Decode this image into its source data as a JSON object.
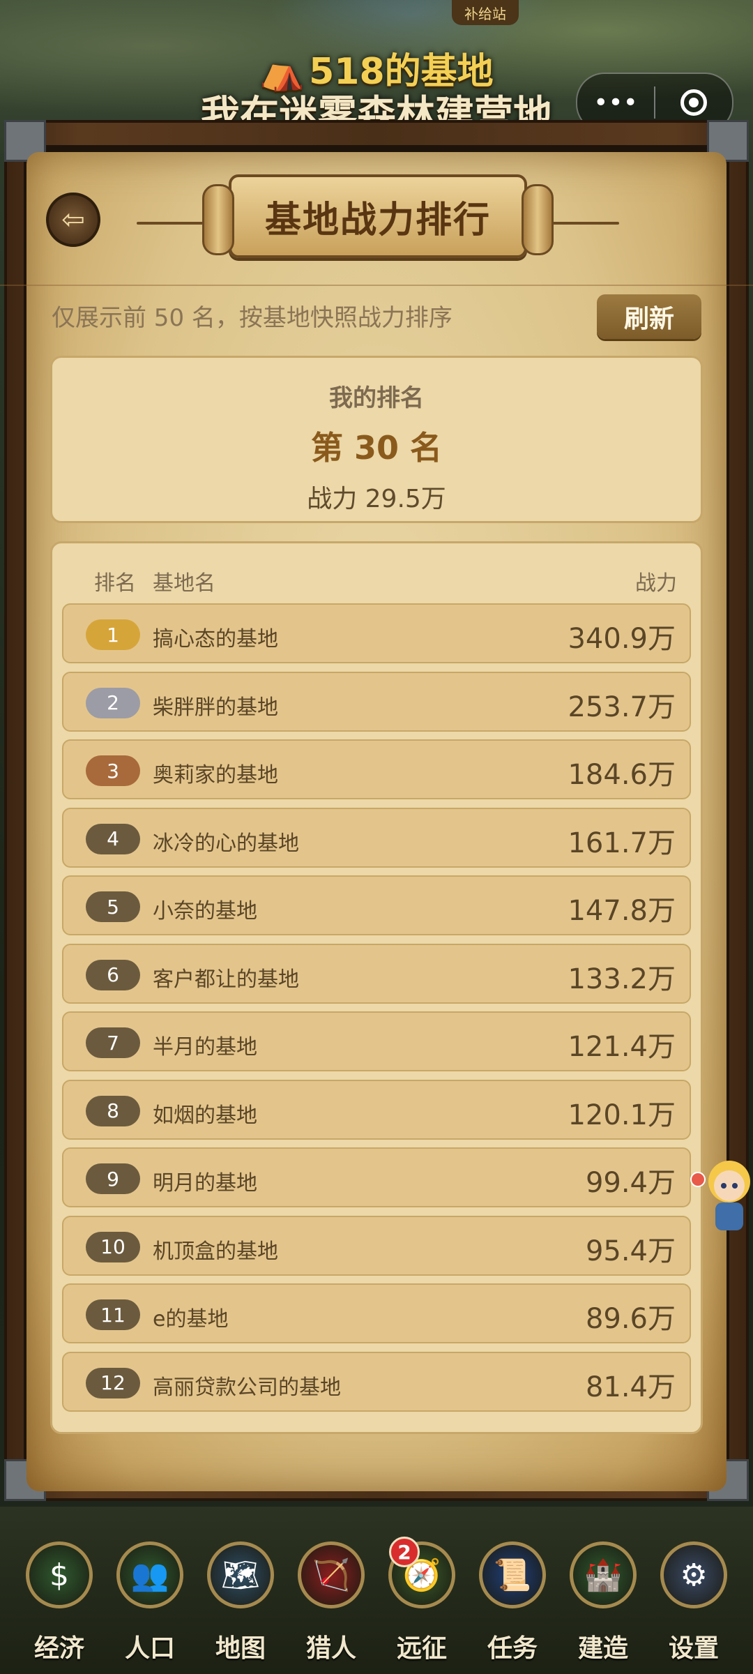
{
  "header": {
    "supply_badge": "补给站",
    "base_title": "518的基地",
    "game_subtitle": "我在迷雾森林建营地",
    "capsule_more": "•••"
  },
  "panel": {
    "title": "基地战力排行",
    "hint": "仅展示前 50 名，按基地快照战力排序",
    "refresh_label": "刷新"
  },
  "my_rank": {
    "label": "我的排名",
    "rank_text": "第 30 名",
    "power_text": "战力 29.5万"
  },
  "table": {
    "headers": {
      "rank": "排名",
      "name": "基地名",
      "power": "战力"
    },
    "rows": [
      {
        "rank": "1",
        "name": "搞心态的基地",
        "power": "340.9万",
        "color": "#d6a53a"
      },
      {
        "rank": "2",
        "name": "柴胖胖的基地",
        "power": "253.7万",
        "color": "#9c9ca6"
      },
      {
        "rank": "3",
        "name": "奥莉家的基地",
        "power": "184.6万",
        "color": "#a86a3a"
      },
      {
        "rank": "4",
        "name": "冰冷的心的基地",
        "power": "161.7万",
        "color": "#6b5a3e"
      },
      {
        "rank": "5",
        "name": "小奈的基地",
        "power": "147.8万",
        "color": "#6b5a3e"
      },
      {
        "rank": "6",
        "name": "客户都让的基地",
        "power": "133.2万",
        "color": "#6b5a3e"
      },
      {
        "rank": "7",
        "name": "半月的基地",
        "power": "121.4万",
        "color": "#6b5a3e"
      },
      {
        "rank": "8",
        "name": "如烟的基地",
        "power": "120.1万",
        "color": "#6b5a3e"
      },
      {
        "rank": "9",
        "name": "明月的基地",
        "power": "99.4万",
        "color": "#6b5a3e"
      },
      {
        "rank": "10",
        "name": "机顶盒的基地",
        "power": "95.4万",
        "color": "#6b5a3e"
      },
      {
        "rank": "11",
        "name": "e的基地",
        "power": "89.6万",
        "color": "#6b5a3e"
      },
      {
        "rank": "12",
        "name": "高丽贷款公司的基地",
        "power": "81.4万",
        "color": "#6b5a3e"
      }
    ]
  },
  "nav": [
    {
      "label": "经济",
      "icon": "coin-icon",
      "glyph": "$",
      "bg": "#2f5a2f"
    },
    {
      "label": "人口",
      "icon": "people-icon",
      "glyph": "👥",
      "bg": "#2f5a2f"
    },
    {
      "label": "地图",
      "icon": "map-icon",
      "glyph": "🗺",
      "bg": "#2f4f66"
    },
    {
      "label": "猎人",
      "icon": "bow-icon",
      "glyph": "🏹",
      "bg": "#8a1f1f"
    },
    {
      "label": "远征",
      "icon": "compass-icon",
      "glyph": "🧭",
      "bg": "#3a5a2a",
      "badge": "2"
    },
    {
      "label": "任务",
      "icon": "scroll-icon",
      "glyph": "📜",
      "bg": "#1f3f7a"
    },
    {
      "label": "建造",
      "icon": "castle-icon",
      "glyph": "🏰",
      "bg": "#2f5a2f"
    },
    {
      "label": "设置",
      "icon": "gear-icon",
      "glyph": "⚙",
      "bg": "#3a4a66"
    }
  ]
}
